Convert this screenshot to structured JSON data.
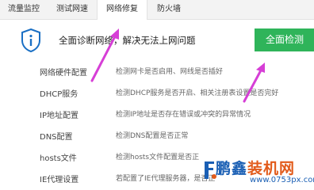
{
  "tabs": [
    {
      "label": "流量监控",
      "active": false
    },
    {
      "label": "测试网速",
      "active": false
    },
    {
      "label": "网络修复",
      "active": true
    },
    {
      "label": "防火墙",
      "active": false
    }
  ],
  "banner": {
    "icon": "info-icon",
    "message": "全面诊断网络，解决无法上网问题",
    "button_label": "全面检测",
    "button_color": "#2fb45a"
  },
  "checks": [
    {
      "name": "网络硬件配置",
      "desc": "检测网卡是否启用、网线是否插好"
    },
    {
      "name": "DHCP服务",
      "desc": "检测DHCP服务是否开启、相关注册表设置是否完好"
    },
    {
      "name": "IP地址配置",
      "desc": "检测IP地址是否存在错误或冲突的异常情况"
    },
    {
      "name": "DNS配置",
      "desc": "检测DNS配置是否正常"
    },
    {
      "name": "hosts文件",
      "desc": "检测hosts文件配置是否正"
    },
    {
      "name": "IE代理设置",
      "desc": "若配置了IE代理服务器，是否正"
    }
  ],
  "watermark": {
    "brand_part1": "鹏鑫",
    "brand_part2": "装机网",
    "url": "www.0753px.com"
  },
  "annotation_color": "#d63fd6"
}
